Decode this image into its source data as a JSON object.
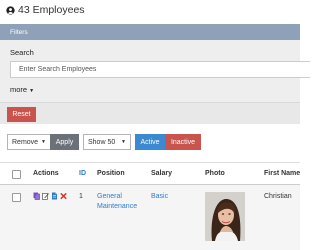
{
  "page": {
    "title": "43 Employees",
    "title_icon": "user-circle-icon"
  },
  "filters": {
    "header": "Filters",
    "search_label": "Search",
    "search_placeholder": "Enter Search Employees",
    "search_value": "",
    "more_label": "more",
    "reset_label": "Reset"
  },
  "toolbar": {
    "bulk_action": "Remove",
    "apply_label": "Apply",
    "page_size": "Show 50",
    "active_label": "Active",
    "inactive_label": "Inactive"
  },
  "table": {
    "columns": [
      "Actions",
      "ID",
      "Position",
      "Salary",
      "Photo",
      "First Name"
    ],
    "rows": [
      {
        "actions": [
          "copy-icon",
          "edit-icon",
          "file-icon",
          "delete-icon"
        ],
        "id": "1",
        "position": "General Maintenance",
        "salary": "Basic",
        "photo": "employee-photo",
        "first_name": "Christian"
      }
    ]
  },
  "colors": {
    "filters_header": "#8fa1b8",
    "reset": "#c9544d",
    "apply": "#6b7178",
    "active": "#3a89d1",
    "inactive": "#c9544d",
    "link": "#2f7cc9"
  }
}
